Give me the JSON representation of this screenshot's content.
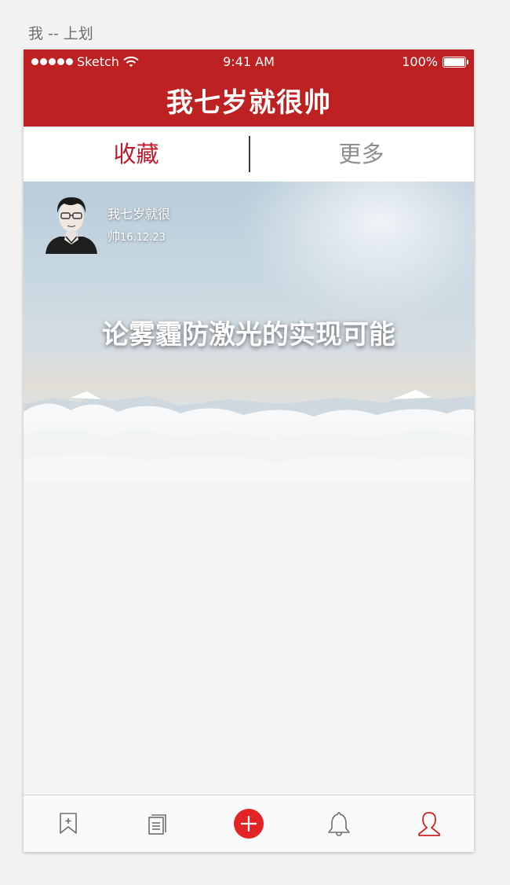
{
  "artboard": {
    "title": "我 -- 上划"
  },
  "status_bar": {
    "carrier": "Sketch",
    "time": "9:41 AM",
    "battery": "100%"
  },
  "nav": {
    "title": "我七岁就很帅"
  },
  "tabs": [
    {
      "label": "收藏",
      "selected": true
    },
    {
      "label": "更多",
      "selected": false
    }
  ],
  "card": {
    "author_name_line1": "我七岁就很",
    "author_name_line2": "帅",
    "date": "16.12.23",
    "headline": "论雾霾防激光的实现可能"
  },
  "tabbar": [
    {
      "icon": "bookmark-add-icon",
      "selected": false
    },
    {
      "icon": "documents-icon",
      "selected": false
    },
    {
      "icon": "add-circle-icon",
      "selected": false
    },
    {
      "icon": "bell-icon",
      "selected": false
    },
    {
      "icon": "user-icon",
      "selected": true
    }
  ],
  "colors": {
    "brand_red": "#be2121",
    "tab_active": "#c0192b",
    "tab_inactive": "#8e8e8e",
    "add_button": "#e22424"
  }
}
